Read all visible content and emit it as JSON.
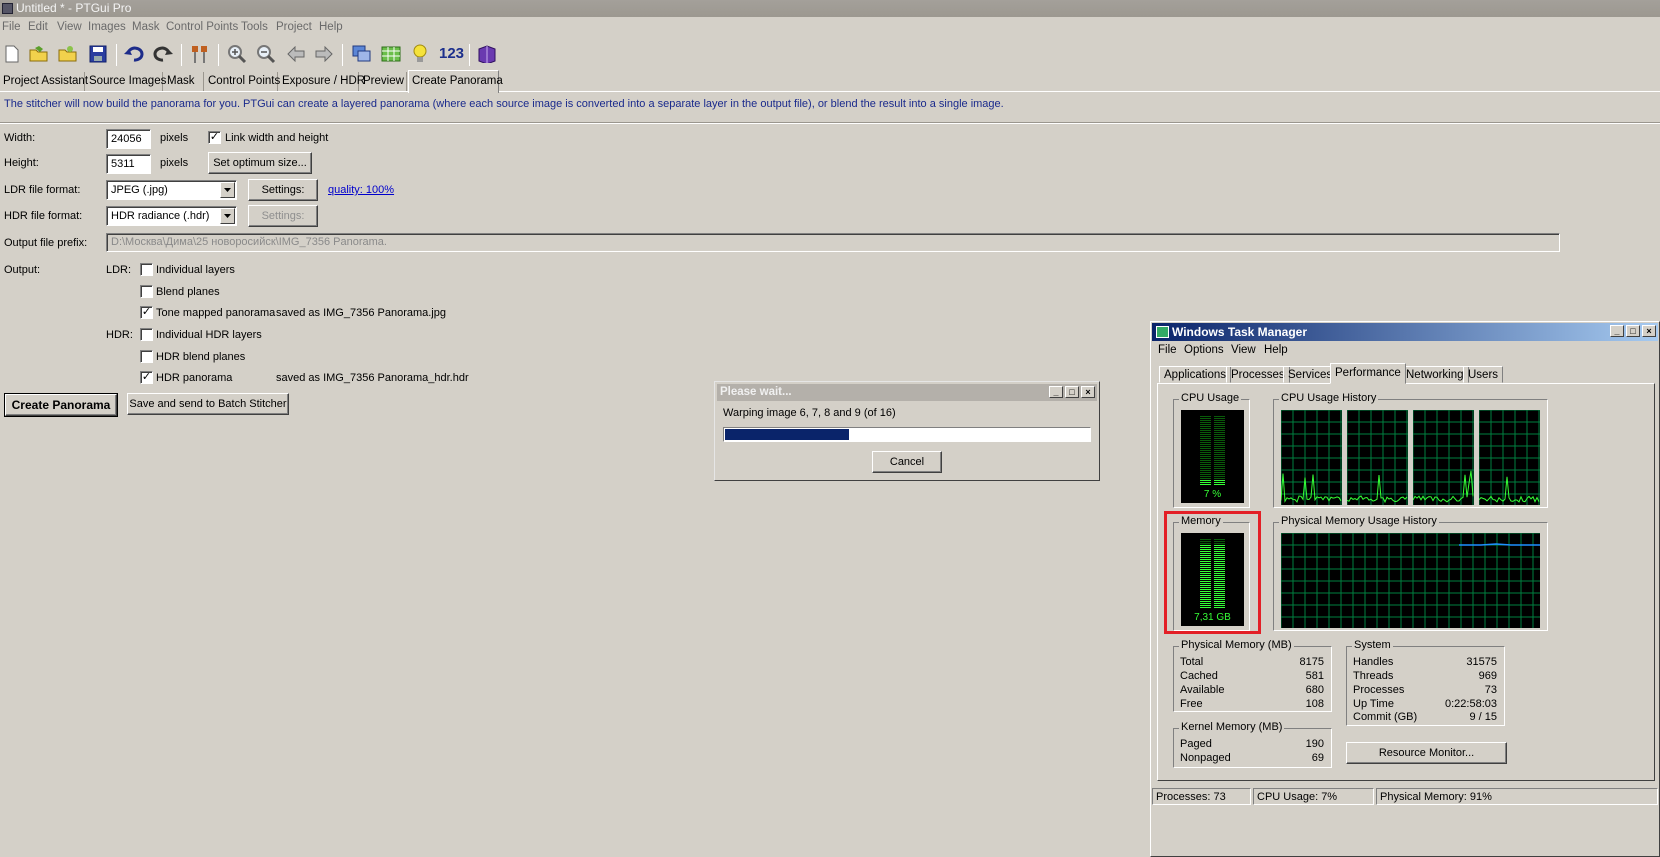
{
  "app": {
    "title": "Untitled * - PTGui Pro",
    "menu": [
      "File",
      "Edit",
      "View",
      "Images",
      "Mask",
      "Control Points",
      "Tools",
      "Project",
      "Help"
    ],
    "toolbar_icons": [
      "new-project-icon",
      "open-project-icon",
      "open-recent-icon",
      "save-icon",
      "undo-icon",
      "redo-icon",
      "align-tools-icon",
      "zoom-in-icon",
      "zoom-out-icon",
      "previous-icon",
      "next-icon",
      "panorama-editor-icon",
      "table-icon",
      "tips-icon",
      "numbers-icon",
      "help-book-icon"
    ],
    "toolbar_text": "123",
    "tabs": [
      "Project Assistant",
      "Source Images",
      "Mask",
      "Control Points",
      "Exposure / HDR",
      "Preview",
      "Create Panorama"
    ],
    "active_tab": "Create Panorama",
    "info": "The stitcher will now build the panorama for you. PTGui can create a layered panorama (where each source image is converted into a separate layer in the output file), or blend the result into a single image."
  },
  "form": {
    "width_label": "Width:",
    "width_value": "24056",
    "height_label": "Height:",
    "height_value": "5311",
    "pixels_label": "pixels",
    "link_label": "Link width and height",
    "link_checked": true,
    "optimum_button": "Set optimum size...",
    "ldr_format_label": "LDR file format:",
    "ldr_format_value": "JPEG (.jpg)",
    "hdr_format_label": "HDR file format:",
    "hdr_format_value": "HDR radiance (.hdr)",
    "settings_button": "Settings:",
    "quality_link": "quality: 100%",
    "prefix_label": "Output file prefix:",
    "prefix_value": "D:\\Москва\\Дима\\25 новоросийск\\IMG_7356 Panorama.",
    "output_label": "Output:",
    "ldr_label": "LDR:",
    "hdr_label": "HDR:",
    "outputs": [
      {
        "label": "Individual layers",
        "checked": false,
        "note": ""
      },
      {
        "label": "Blend planes",
        "checked": false,
        "note": ""
      },
      {
        "label": "Tone mapped panorama",
        "checked": true,
        "note": "saved as IMG_7356 Panorama.jpg"
      },
      {
        "label": "Individual HDR layers",
        "checked": false,
        "note": ""
      },
      {
        "label": "HDR blend planes",
        "checked": false,
        "note": ""
      },
      {
        "label": "HDR panorama",
        "checked": true,
        "note": "saved as IMG_7356 Panorama_hdr.hdr"
      }
    ],
    "create_button": "Create Panorama",
    "batch_button": "Save and send to Batch Stitcher"
  },
  "wait_dialog": {
    "title": "Please wait...",
    "message": "Warping image 6, 7, 8 and 9 (of 16)",
    "progress": 0.34,
    "cancel": "Cancel"
  },
  "task_manager": {
    "title": "Windows Task Manager",
    "menu": [
      "File",
      "Options",
      "View",
      "Help"
    ],
    "tabs": [
      "Applications",
      "Processes",
      "Services",
      "Performance",
      "Networking",
      "Users"
    ],
    "active_tab": "Performance",
    "cpu_usage_label": "CPU Usage",
    "cpu_usage_value": "7 %",
    "cpu_usage_fraction": 0.07,
    "cpu_history_label": "CPU Usage History",
    "memory_label": "Memory",
    "memory_value": "7,31 GB",
    "memory_fraction": 0.91,
    "memory_history_label": "Physical Memory Usage History",
    "physical_memory": {
      "title": "Physical Memory (MB)",
      "rows": [
        {
          "k": "Total",
          "v": "8175"
        },
        {
          "k": "Cached",
          "v": "581"
        },
        {
          "k": "Available",
          "v": "680"
        },
        {
          "k": "Free",
          "v": "108"
        }
      ]
    },
    "kernel_memory": {
      "title": "Kernel Memory (MB)",
      "rows": [
        {
          "k": "Paged",
          "v": "190"
        },
        {
          "k": "Nonpaged",
          "v": "69"
        }
      ]
    },
    "system": {
      "title": "System",
      "rows": [
        {
          "k": "Handles",
          "v": "31575"
        },
        {
          "k": "Threads",
          "v": "969"
        },
        {
          "k": "Processes",
          "v": "73"
        },
        {
          "k": "Up Time",
          "v": "0:22:58:03"
        },
        {
          "k": "Commit (GB)",
          "v": "9 / 15"
        }
      ]
    },
    "resource_monitor_button": "Resource Monitor...",
    "status": {
      "processes": "Processes: 73",
      "cpu": "CPU Usage: 7%",
      "memory": "Physical Memory: 91%"
    },
    "colors": {
      "meter": "#36ff36",
      "grid": "#008040",
      "history_line": "#1e90ff",
      "highlight": "#e31f26"
    }
  }
}
